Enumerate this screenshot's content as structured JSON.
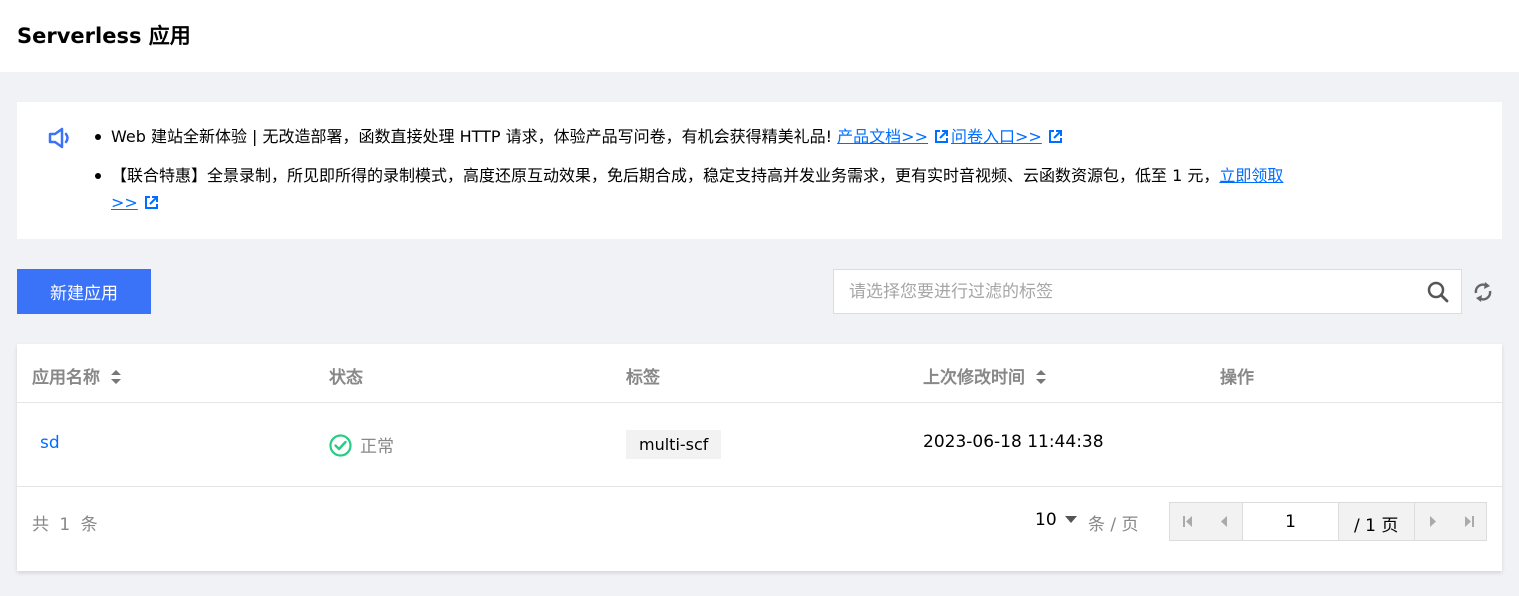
{
  "header": {
    "title": "Serverless 应用"
  },
  "notice": {
    "icon": "speaker-icon",
    "item1": {
      "text": "Web 建站全新体验 | 无改造部署，函数直接处理 HTTP 请求，体验产品写问卷，有机会获得精美礼品!",
      "link1": "产品文档>>",
      "link2": "问卷入口>>"
    },
    "item2": {
      "text": "【联合特惠】全景录制，所见即所得的录制模式，高度还原互动效果，免后期合成，稳定支持高并发业务需求，更有实时音视频、云函数资源包，低至 1 元，",
      "link_part1": "立即领取",
      "link_part2": ">>"
    }
  },
  "toolbar": {
    "new_button": "新建应用",
    "search_placeholder": "请选择您要进行过滤的标签"
  },
  "table": {
    "columns": [
      "应用名称",
      "状态",
      "标签",
      "上次修改时间",
      "操作"
    ],
    "rows": [
      {
        "name": "sd",
        "status": "正常",
        "tag": "multi-scf",
        "modified": "2023-06-18 11:44:38",
        "action": ""
      }
    ]
  },
  "pagination": {
    "total": "共 1 条",
    "page_size": "10",
    "per_page": "条 / 页",
    "current_page": "1",
    "total_pages": "/ 1 页"
  },
  "colors": {
    "primary": "#3a72f8",
    "link": "#006eff",
    "success": "#29cc85",
    "background": "#f1f2f5"
  }
}
